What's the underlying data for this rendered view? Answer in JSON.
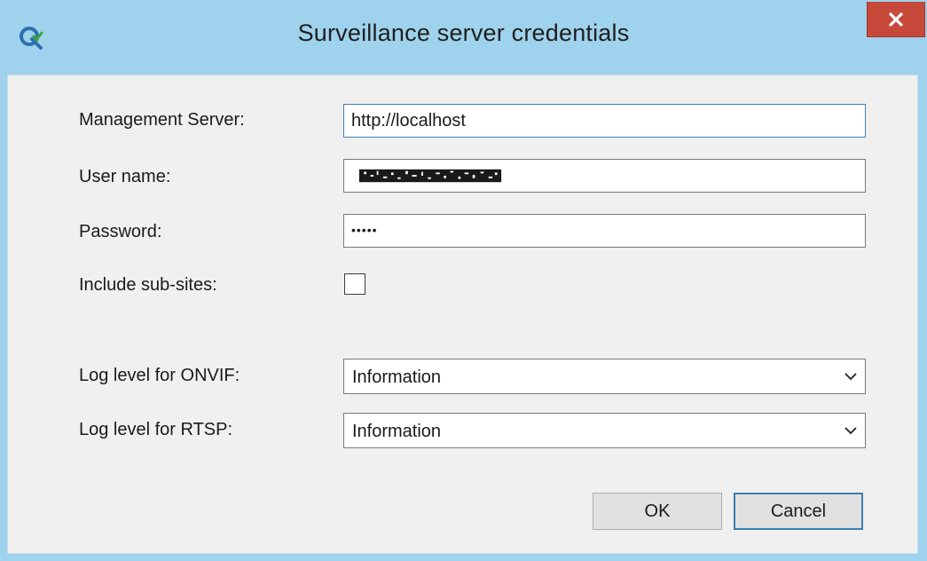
{
  "window": {
    "title": "Surveillance server credentials",
    "app_icon": "green-q-refresh-icon",
    "close_glyph": "x",
    "colors": {
      "titlebar": "#9fd2ec",
      "close_button": "#c7493a",
      "client_background": "#f0f0f0"
    }
  },
  "form": {
    "management_server": {
      "label": "Management Server:",
      "value": "http://localhost"
    },
    "user_name": {
      "label": "User name:",
      "value_redacted": true
    },
    "password": {
      "label": "Password:",
      "value": "•••••"
    },
    "include_subsites": {
      "label": "Include sub-sites:",
      "checked": false
    },
    "log_level_onvif": {
      "label": "Log level for ONVIF:",
      "selected": "Information"
    },
    "log_level_rtsp": {
      "label": "Log level for RTSP:",
      "selected": "Information"
    }
  },
  "buttons": {
    "ok_label": "OK",
    "cancel_label": "Cancel"
  }
}
